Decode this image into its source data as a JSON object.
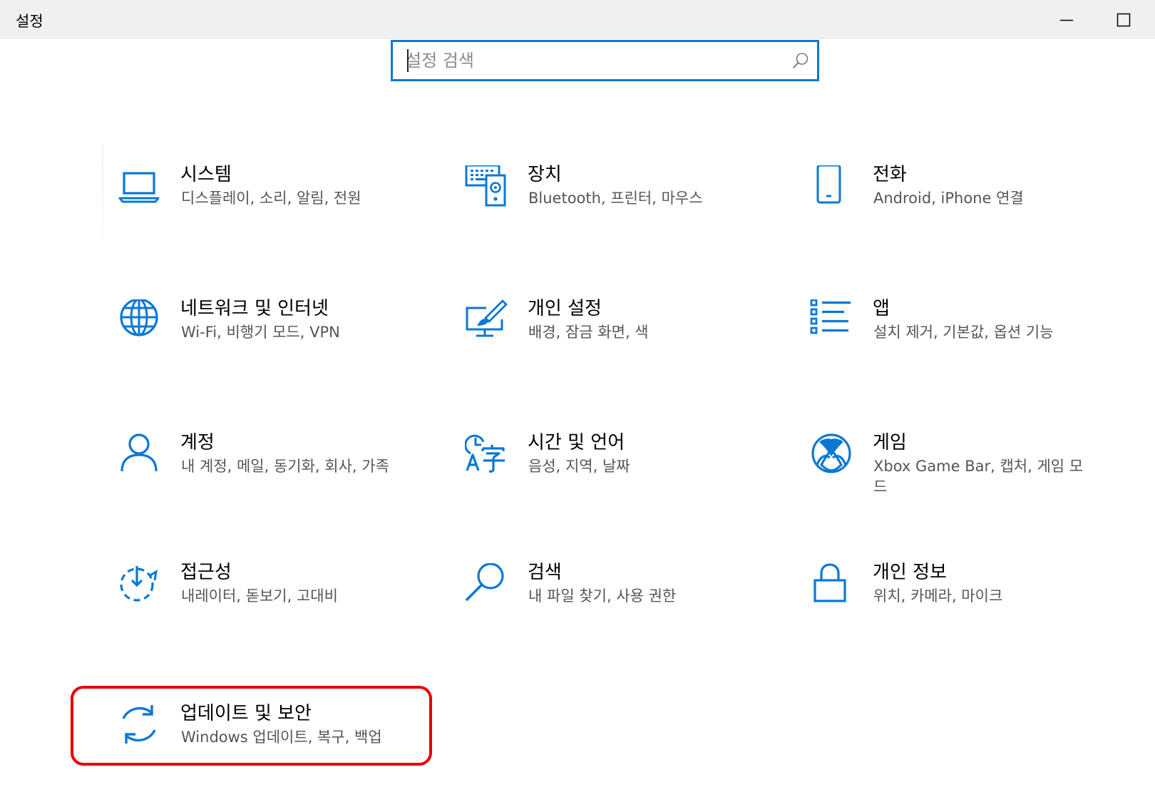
{
  "window": {
    "title": "설정"
  },
  "search": {
    "placeholder": "설정 검색",
    "value": ""
  },
  "tiles": [
    {
      "title": "시스템",
      "desc": "디스플레이, 소리, 알림, 전원",
      "icon": "laptop-icon"
    },
    {
      "title": "장치",
      "desc": "Bluetooth, 프린터, 마우스",
      "icon": "devices-icon"
    },
    {
      "title": "전화",
      "desc": "Android, iPhone 연결",
      "icon": "phone-icon"
    },
    {
      "title": "네트워크 및 인터넷",
      "desc": "Wi-Fi, 비행기 모드, VPN",
      "icon": "globe-icon"
    },
    {
      "title": "개인 설정",
      "desc": "배경, 잠금 화면, 색",
      "icon": "personalization-icon"
    },
    {
      "title": "앱",
      "desc": "설치 제거, 기본값, 옵션 기능",
      "icon": "apps-list-icon"
    },
    {
      "title": "계정",
      "desc": "내 계정, 메일, 동기화, 회사, 가족",
      "icon": "person-icon"
    },
    {
      "title": "시간 및 언어",
      "desc": "음성, 지역, 날짜",
      "icon": "time-language-icon"
    },
    {
      "title": "게임",
      "desc": "Xbox Game Bar, 캡처, 게임 모드",
      "icon": "xbox-icon"
    },
    {
      "title": "접근성",
      "desc": "내레이터, 돋보기, 고대비",
      "icon": "ease-of-access-icon"
    },
    {
      "title": "검색",
      "desc": "내 파일 찾기, 사용 권한",
      "icon": "magnifier-icon"
    },
    {
      "title": "개인 정보",
      "desc": "위치, 카메라, 마이크",
      "icon": "lock-icon"
    },
    {
      "title": "업데이트 및 보안",
      "desc": "Windows 업데이트, 복구, 백업",
      "icon": "refresh-icon"
    }
  ],
  "colors": {
    "accent": "#0a78d4",
    "highlight": "#e60000",
    "titlebar": "#f0f0f0"
  }
}
